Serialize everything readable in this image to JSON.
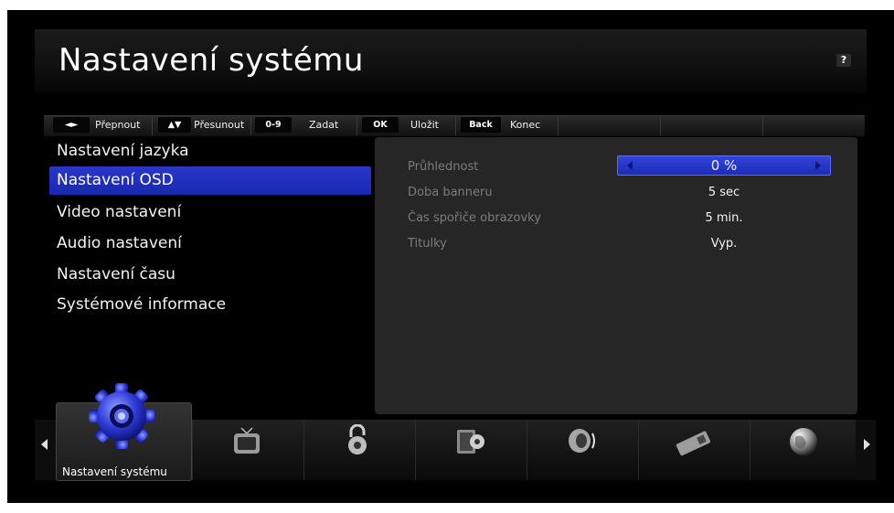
{
  "header": {
    "title": "Nastavení systému",
    "help_label": "?"
  },
  "hints": [
    {
      "key": "◄►",
      "label": "Přepnout"
    },
    {
      "key": "▲▼",
      "label": "Přesunout"
    },
    {
      "key": "0-9",
      "label": "Zadat"
    },
    {
      "key": "OK",
      "label": "Uložit"
    },
    {
      "key": "Back",
      "label": "Konec"
    }
  ],
  "menu": {
    "items": [
      {
        "label": "Nastavení jazyka"
      },
      {
        "label": "Nastavení OSD"
      },
      {
        "label": "Video nastavení"
      },
      {
        "label": "Audio nastavení"
      },
      {
        "label": "Nastavení času"
      },
      {
        "label": "Systémové informace"
      }
    ],
    "selected_index": 1
  },
  "settings": [
    {
      "label": "Průhlednost",
      "value": "0 %"
    },
    {
      "label": "Doba banneru",
      "value": "5 sec"
    },
    {
      "label": "Čas spořiče obrazovky",
      "value": "5 min."
    },
    {
      "label": "Titulky",
      "value": "Vyp."
    }
  ],
  "dock": {
    "active_label": "Nastavení systému",
    "icons": [
      "gear-icon",
      "tv-icon",
      "lock-icon",
      "media-icon",
      "speaker-icon",
      "card-icon",
      "globe-icon"
    ]
  },
  "colors": {
    "accent": "#2233cc",
    "background": "#000000",
    "panel": "#262626"
  }
}
